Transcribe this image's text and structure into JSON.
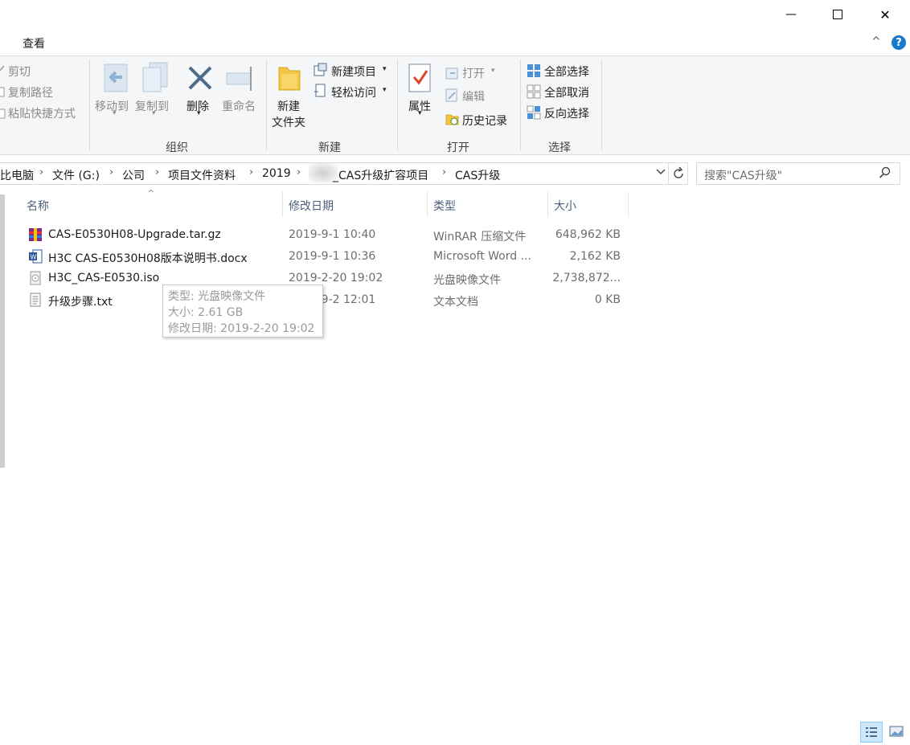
{
  "window": {
    "minimize_glyph": "—",
    "maximize_glyph": "☐",
    "close_glyph": "✕"
  },
  "tabs": {
    "view_label": "查看",
    "help_glyph": "?",
    "collapse_glyph": "^"
  },
  "ribbon": {
    "clipboard": {
      "cut": "剪切",
      "copy_path": "复制路径",
      "paste_shortcut": "粘贴快捷方式"
    },
    "organize": {
      "label": "组织",
      "move_to": "移动到",
      "copy_to": "复制到",
      "delete": "删除",
      "rename": "重命名"
    },
    "new": {
      "label": "新建",
      "new_folder_line1": "新建",
      "new_folder_line2": "文件夹",
      "new_item": "新建项目",
      "easy_access": "轻松访问"
    },
    "open": {
      "label": "打开",
      "properties": "属性",
      "open": "打开",
      "edit": "编辑",
      "history": "历史记录"
    },
    "select": {
      "label": "选择",
      "select_all": "全部选择",
      "select_none": "全部取消",
      "invert": "反向选择"
    }
  },
  "address": {
    "crumbs": [
      "比电脑",
      "文件 (G:)",
      "公司",
      "项目文件资料",
      "2019",
      "_CAS升级扩容项目",
      "CAS升级"
    ],
    "search_placeholder": "搜索\"CAS升级\""
  },
  "columns": {
    "name": "名称",
    "date": "修改日期",
    "type": "类型",
    "size": "大小",
    "sort_glyph": "^"
  },
  "files": [
    {
      "name": "CAS-E0530H08-Upgrade.tar.gz",
      "date": "2019-9-1 10:40",
      "type": "WinRAR 压缩文件",
      "size": "648,962 KB",
      "icon": "winrar-icon"
    },
    {
      "name": "H3C CAS-E0530H08版本说明书.docx",
      "date": "2019-9-1 10:36",
      "type": "Microsoft Word ...",
      "size": "2,162 KB",
      "icon": "word-icon"
    },
    {
      "name": "H3C_CAS-E0530.iso",
      "date": "2019-2-20 19:02",
      "type": "光盘映像文件",
      "size": "2,738,872...",
      "icon": "disc-image-icon"
    },
    {
      "name": "升级步骤.txt",
      "date": "2019-9-2 12:01",
      "type": "文本文档",
      "size": "0 KB",
      "icon": "text-file-icon"
    }
  ],
  "tooltip": {
    "type": "类型: 光盘映像文件",
    "size": "大小: 2.61 GB",
    "modified": "修改日期: 2019-2-20 19:02"
  },
  "colors": {
    "accent": "#1979ca",
    "ribbon_bg": "#f5f6f7",
    "folder": "#f4c542"
  }
}
